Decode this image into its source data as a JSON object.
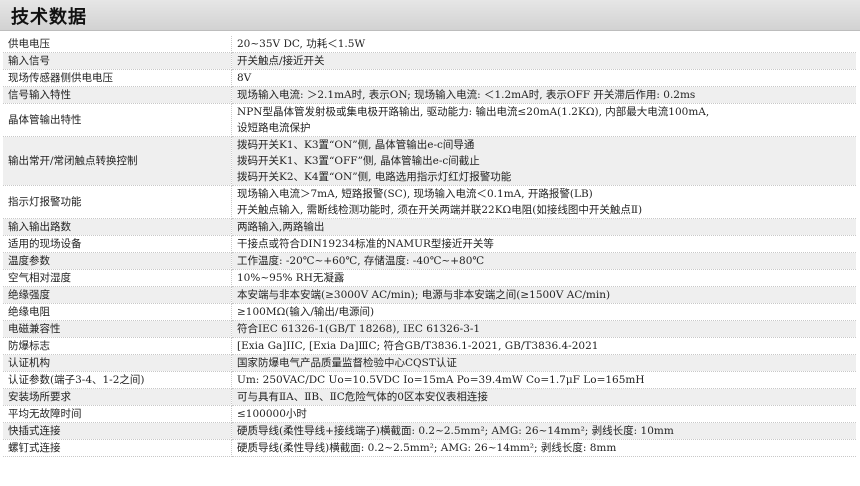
{
  "title": "技术数据",
  "rows": [
    {
      "key": "供电电压",
      "lines": [
        "20~35V DC, 功耗＜1.5W"
      ]
    },
    {
      "key": "输入信号",
      "lines": [
        "开关触点/接近开关"
      ]
    },
    {
      "key": "现场传感器侧供电电压",
      "lines": [
        "8V"
      ]
    },
    {
      "key": "信号输入特性",
      "lines": [
        "现场输入电流: ＞2.1mA时, 表示ON; 现场输入电流: ＜1.2mA时, 表示OFF        开关滞后作用: 0.2ms"
      ]
    },
    {
      "key": "晶体管输出特性",
      "lines": [
        "NPN型晶体管发射极或集电极开路输出, 驱动能力: 输出电流≤20mA(1.2KΩ), 内部最大电流100mA,",
        "设短路电流保护"
      ]
    },
    {
      "key": "输出常开/常闭触点转换控制",
      "lines": [
        "拨码开关K1、K3置“ON”侧, 晶体管输出e-c间导通",
        "拨码开关K1、K3置“OFF”侧, 晶体管输出e-c间截止",
        "拨码开关K2、K4置“ON”侧, 电路选用指示灯红灯报警功能"
      ]
    },
    {
      "key": "指示灯报警功能",
      "lines": [
        "现场输入电流＞7mA, 短路报警(SC), 现场输入电流＜0.1mA, 开路报警(LB)",
        "开关触点输入, 需断线检测功能时, 须在开关两端并联22KΩ电阻(如接线图中开关触点Ⅱ)"
      ]
    },
    {
      "key": "输入输出路数",
      "lines": [
        "两路输入,两路输出"
      ]
    },
    {
      "key": "适用的现场设备",
      "lines": [
        "干接点或符合DIN19234标准的NAMUR型接近开关等"
      ]
    },
    {
      "key": "温度参数",
      "lines": [
        "工作温度: -20℃~+60℃, 存储温度: -40℃~+80℃"
      ]
    },
    {
      "key": "空气相对湿度",
      "lines": [
        "10%~95% RH无凝露"
      ]
    },
    {
      "key": "绝缘强度",
      "lines": [
        "本安端与非本安端(≥3000V AC/min); 电源与非本安端之间(≥1500V AC/min)"
      ]
    },
    {
      "key": "绝缘电阻",
      "lines": [
        "≥100MΩ(输入/输出/电源间)"
      ]
    },
    {
      "key": "电磁兼容性",
      "lines": [
        "符合IEC 61326-1(GB/T 18268), IEC 61326-3-1"
      ]
    },
    {
      "key": "防爆标志",
      "lines": [
        "[Exia Ga]IIC, [Exia Da]ⅢC; 符合GB/T3836.1-2021, GB/T3836.4-2021"
      ]
    },
    {
      "key": "认证机构",
      "lines": [
        "国家防爆电气产品质量监督检验中心CQST认证"
      ]
    },
    {
      "key": "认证参数(端子3-4、1-2之间)",
      "lines": [
        "Um: 250VAC/DC          Uo=10.5VDC        Io=15mA        Po=39.4mW        Co=1.7μF        Lo=165mH"
      ]
    },
    {
      "key": "安装场所要求",
      "lines": [
        "可与具有ⅡA、ⅡB、ⅡC危险气体的0区本安仪表相连接"
      ]
    },
    {
      "key": "平均无故障时间",
      "lines": [
        "≤100000小时"
      ]
    },
    {
      "key": "快插式连接",
      "lines": [
        "硬质导线(柔性导线+接线端子)横截面: 0.2~2.5mm²; AMG:  26~14mm²; 剥线长度: 10mm"
      ]
    },
    {
      "key": "螺钉式连接",
      "lines": [
        "硬质导线(柔性导线)横截面: 0.2~2.5mm²; AMG:  26~14mm²; 剥线长度: 8mm"
      ]
    }
  ]
}
